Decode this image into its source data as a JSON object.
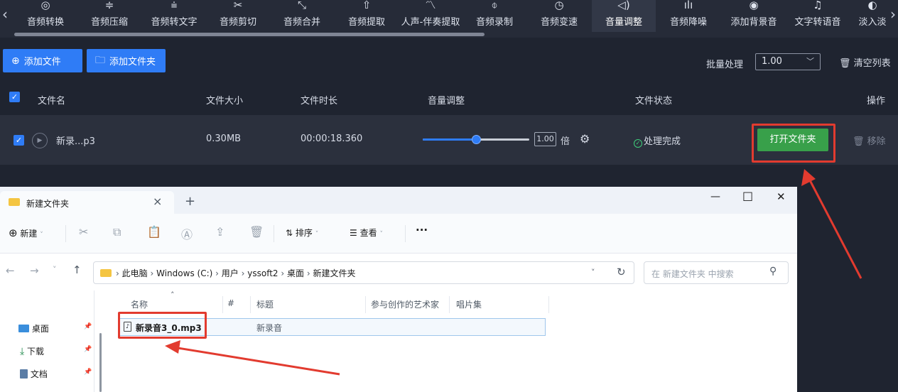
{
  "toolbar": {
    "left_arrow": "‹",
    "right_arrow": "›",
    "items": [
      {
        "label": "音频转换",
        "icon": "◎"
      },
      {
        "label": "音频压缩",
        "icon": "≑"
      },
      {
        "label": "音频转文字",
        "icon": "⩧"
      },
      {
        "label": "音频剪切",
        "icon": "✂"
      },
      {
        "label": "音频合并",
        "icon": "⤡"
      },
      {
        "label": "音频提取",
        "icon": "⇧"
      },
      {
        "label": "人声-伴奏提取",
        "icon": "〽"
      },
      {
        "label": "音频录制",
        "icon": "⌽"
      },
      {
        "label": "音频变速",
        "icon": "◷"
      },
      {
        "label": "音量调整",
        "icon": "◁)"
      },
      {
        "label": "音频降噪",
        "icon": "ılı"
      },
      {
        "label": "添加背景音",
        "icon": "◉"
      },
      {
        "label": "文字转语音",
        "icon": "♫"
      },
      {
        "label": "淡入淡",
        "icon": "◐"
      }
    ],
    "active_index": 9
  },
  "actions": {
    "add_file": "添加文件",
    "add_folder": "添加文件夹",
    "batch_label": "批量处理",
    "batch_value": "1.00",
    "clear_list": "清空列表"
  },
  "table": {
    "headers": {
      "filename": "文件名",
      "size": "文件大小",
      "duration": "文件时长",
      "volume": "音量调整",
      "status": "文件状态",
      "operation": "操作"
    },
    "rows": [
      {
        "filename": "新录...p3",
        "size": "0.30MB",
        "duration": "00:00:18.360",
        "volume_value": "1.00",
        "volume_unit": "倍",
        "volume_fraction": 0.5,
        "status": "处理完成",
        "open_folder": "打开文件夹",
        "remove": "移除"
      }
    ]
  },
  "explorer": {
    "tab_title": "新建文件夹",
    "tab_close": "×",
    "new_tab": "+",
    "win_min": "—",
    "win_max": "□",
    "win_close": "✕",
    "cmd": {
      "new": "新建",
      "sort": "排序",
      "view": "查看",
      "more": "···"
    },
    "breadcrumb": [
      "此电脑",
      "Windows (C:)",
      "用户",
      "yssoft2",
      "桌面",
      "新建文件夹"
    ],
    "search_placeholder": "在 新建文件夹 中搜索",
    "columns": {
      "name": "名称",
      "number": "#",
      "title": "标题",
      "artist": "参与创作的艺术家",
      "album": "唱片集"
    },
    "files": [
      {
        "name": "新录音3_0.mp3",
        "title": "新录音"
      }
    ],
    "sidebar": [
      {
        "label": "桌面",
        "pin": "📌"
      },
      {
        "label": "下载",
        "pin": "📌"
      },
      {
        "label": "文档",
        "pin": "📌"
      }
    ]
  },
  "colors": {
    "accent": "#2f7cf6",
    "success": "#38a04a",
    "highlight": "#e23b2f"
  }
}
